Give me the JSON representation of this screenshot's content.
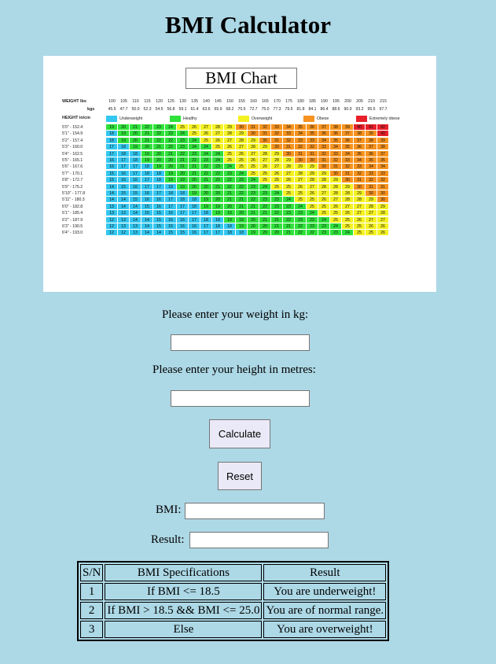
{
  "page": {
    "title": "BMI Calculator"
  },
  "chart": {
    "title": "BMI Chart",
    "weight_lbs_label": "WEIGHT lbs",
    "weight_kgs_label": "kgs",
    "height_label": "HEIGHT in/cm",
    "lbs": [
      "100",
      "105",
      "110",
      "115",
      "120",
      "125",
      "130",
      "135",
      "140",
      "145",
      "150",
      "155",
      "160",
      "165",
      "170",
      "175",
      "180",
      "185",
      "190",
      "195",
      "200",
      "205",
      "210",
      "215"
    ],
    "kgs": [
      "45.5",
      "47.7",
      "50.0",
      "52.3",
      "54.5",
      "56.8",
      "59.1",
      "61.4",
      "63.6",
      "65.9",
      "68.2",
      "70.5",
      "72.7",
      "75.0",
      "77.3",
      "79.5",
      "81.8",
      "84.1",
      "86.4",
      "88.6",
      "90.9",
      "93.2",
      "95.5",
      "97.7"
    ],
    "legend": [
      {
        "label": "Underweight",
        "color": "#33c7f0"
      },
      {
        "label": "Healthy",
        "color": "#2fe23a"
      },
      {
        "label": "Overweight",
        "color": "#f5f222"
      },
      {
        "label": "Obese",
        "color": "#f7931e"
      },
      {
        "label": "Extremely obese",
        "color": "#e8202a"
      }
    ],
    "rows": [
      {
        "h": "5'0\" - 152.4",
        "v": [
          19,
          20,
          21,
          22,
          23,
          24,
          25,
          26,
          27,
          28,
          29,
          30,
          31,
          32,
          33,
          34,
          35,
          36,
          37,
          38,
          39,
          40,
          41,
          42
        ]
      },
      {
        "h": "5'1\" - 154.9",
        "v": [
          18,
          19,
          20,
          21,
          22,
          23,
          24,
          25,
          26,
          27,
          28,
          29,
          30,
          31,
          32,
          33,
          34,
          35,
          36,
          36,
          37,
          38,
          39,
          40
        ]
      },
      {
        "h": "5'2\" - 157.4",
        "v": [
          18,
          19,
          20,
          21,
          22,
          22,
          23,
          24,
          25,
          26,
          27,
          28,
          29,
          30,
          31,
          32,
          33,
          33,
          34,
          35,
          36,
          37,
          38,
          39
        ]
      },
      {
        "h": "5'3\" - 160.0",
        "v": [
          17,
          18,
          19,
          20,
          21,
          22,
          23,
          24,
          24,
          25,
          26,
          27,
          28,
          29,
          30,
          31,
          32,
          32,
          33,
          34,
          35,
          36,
          37,
          38
        ]
      },
      {
        "h": "5'4\" - 162.5",
        "v": [
          17,
          18,
          18,
          19,
          20,
          21,
          22,
          23,
          24,
          24,
          25,
          26,
          27,
          28,
          29,
          30,
          31,
          31,
          32,
          33,
          34,
          35,
          36,
          37
        ]
      },
      {
        "h": "5'5\" - 165.1",
        "v": [
          16,
          17,
          18,
          19,
          20,
          20,
          21,
          22,
          23,
          24,
          25,
          25,
          26,
          27,
          28,
          29,
          30,
          30,
          31,
          32,
          33,
          34,
          35,
          35
        ]
      },
      {
        "h": "5'6\" - 167.6",
        "v": [
          16,
          17,
          17,
          18,
          19,
          20,
          21,
          21,
          22,
          23,
          24,
          25,
          25,
          26,
          27,
          28,
          29,
          29,
          30,
          31,
          32,
          33,
          34,
          34
        ]
      },
      {
        "h": "5'7\" - 170.1",
        "v": [
          15,
          16,
          17,
          18,
          18,
          19,
          20,
          21,
          22,
          22,
          23,
          24,
          25,
          25,
          26,
          27,
          28,
          29,
          29,
          30,
          31,
          32,
          33,
          33
        ]
      },
      {
        "h": "5'8\" - 172.7",
        "v": [
          15,
          16,
          16,
          17,
          18,
          19,
          19,
          20,
          21,
          22,
          22,
          23,
          24,
          25,
          25,
          26,
          27,
          28,
          28,
          29,
          30,
          31,
          32,
          32
        ]
      },
      {
        "h": "5'9\" - 175.2",
        "v": [
          14,
          15,
          16,
          17,
          17,
          18,
          19,
          20,
          20,
          21,
          22,
          22,
          23,
          24,
          25,
          25,
          26,
          27,
          28,
          28,
          29,
          30,
          31,
          31
        ]
      },
      {
        "h": "5'10\" - 177.8",
        "v": [
          14,
          15,
          15,
          16,
          17,
          18,
          18,
          19,
          20,
          20,
          21,
          22,
          23,
          23,
          24,
          25,
          25,
          26,
          27,
          28,
          28,
          29,
          30,
          30
        ]
      },
      {
        "h": "5'11\" - 180.3",
        "v": [
          14,
          14,
          15,
          16,
          16,
          17,
          18,
          18,
          19,
          20,
          21,
          21,
          22,
          23,
          23,
          24,
          25,
          25,
          26,
          27,
          28,
          28,
          29,
          30
        ]
      },
      {
        "h": "6'0\" - 182.8",
        "v": [
          13,
          14,
          14,
          15,
          16,
          17,
          17,
          18,
          19,
          19,
          20,
          21,
          21,
          22,
          23,
          23,
          24,
          25,
          25,
          26,
          27,
          27,
          28,
          29
        ]
      },
      {
        "h": "6'1\" - 185.4",
        "v": [
          13,
          13,
          14,
          15,
          15,
          16,
          17,
          17,
          18,
          19,
          19,
          20,
          21,
          21,
          22,
          23,
          23,
          24,
          25,
          25,
          26,
          27,
          27,
          28
        ]
      },
      {
        "h": "6'2\" - 187.9",
        "v": [
          12,
          13,
          14,
          14,
          15,
          16,
          16,
          17,
          18,
          18,
          19,
          19,
          20,
          21,
          21,
          22,
          23,
          23,
          24,
          25,
          25,
          26,
          27,
          27
        ]
      },
      {
        "h": "6'3\" - 190.5",
        "v": [
          12,
          13,
          13,
          14,
          15,
          15,
          16,
          16,
          17,
          18,
          18,
          19,
          20,
          20,
          21,
          21,
          22,
          23,
          23,
          24,
          25,
          25,
          26,
          26
        ]
      },
      {
        "h": "6'4\" - 193.0",
        "v": [
          12,
          12,
          13,
          14,
          14,
          15,
          15,
          16,
          17,
          17,
          18,
          18,
          19,
          20,
          20,
          21,
          22,
          22,
          23,
          23,
          24,
          25,
          25,
          26
        ]
      }
    ]
  },
  "form": {
    "weight_label": "Please enter your weight in kg:",
    "weight_value": "",
    "height_label": "Please enter your height in metres:",
    "height_value": "",
    "calculate_label": "Calculate",
    "reset_label": "Reset",
    "bmi_label": "BMI:",
    "bmi_value": "",
    "result_label": "Result:",
    "result_value": ""
  },
  "table": {
    "headers": [
      "S/N",
      "BMI Specifications",
      "Result"
    ],
    "rows": [
      [
        "1",
        "If BMI <= 18.5",
        "You are underweight!"
      ],
      [
        "2",
        "If BMI > 18.5 && BMI <= 25.0",
        "You are of normal range."
      ],
      [
        "3",
        "Else",
        "You are overweight!"
      ]
    ]
  }
}
